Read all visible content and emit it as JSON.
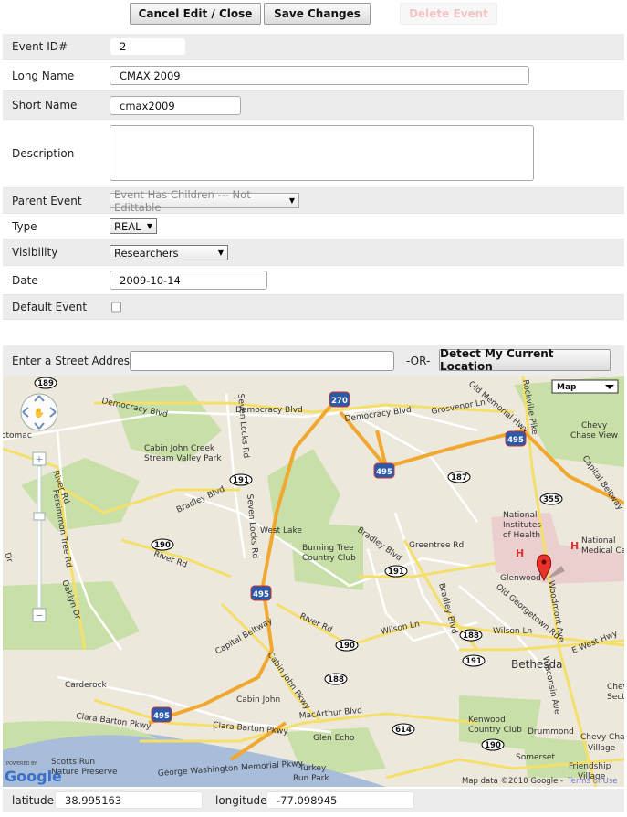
{
  "toolbar": {
    "cancel_label": "Cancel Edit / Close",
    "save_label": "Save Changes",
    "delete_label": "Delete Event"
  },
  "form": {
    "event_id": {
      "label": "Event ID#",
      "value": "2"
    },
    "long_name": {
      "label": "Long Name",
      "value": "CMAX 2009"
    },
    "short_name": {
      "label": "Short Name",
      "value": "cmax2009"
    },
    "description": {
      "label": "Description",
      "value": ""
    },
    "parent_event": {
      "label": "Parent Event",
      "value": "Event Has Children --- Not Edittable"
    },
    "type": {
      "label": "Type",
      "value": "REAL"
    },
    "visibility": {
      "label": "Visibility",
      "value": "Researchers"
    },
    "date": {
      "label": "Date",
      "value": "2009-10-14"
    },
    "default_event": {
      "label": "Default Event",
      "checked": false
    }
  },
  "address": {
    "label": "Enter a Street Address:",
    "value": "",
    "or_label": "-OR-",
    "detect_label": "Detect My Current Location"
  },
  "map": {
    "type_selector": "Map",
    "attribution": "Map data ©2010 Google - ",
    "terms_label": "Terms of Use",
    "logo_powered": "POWERED BY",
    "logo_text": "Google",
    "places": [
      "Cabin John Creek",
      "Stream Valley Park",
      "West Lake",
      "Burning Tree",
      "Country Club",
      "Carderock",
      "Cabin John",
      "Glen Echo",
      "Bethesda",
      "Glenwood",
      "National",
      "Institutes",
      "of Health",
      "National",
      "Medical Ce",
      "Chevy",
      "Chase View",
      "Kenwood",
      "Country Club",
      "Drummond",
      "Somerset",
      "Chevy Cha",
      "Village",
      "Friendship",
      "Village",
      "Scotts Run",
      "Nature Preserve",
      "Turkey",
      "Run Park",
      "otomac",
      "Chev",
      "Sect"
    ],
    "roads": [
      "Democracy Blvd",
      "Democracy Blvd",
      "Democracy Blvd",
      "Grosvenor Ln",
      "Old Memorial Hwy",
      "Rockville Pike",
      "Capital Beltway",
      "Bradley Blvd",
      "Seven Locks Rd",
      "Seven Locks Rd",
      "River Rd",
      "Persimmon Tree Rd",
      "Oaklyn Dr",
      "Bradley Blvd",
      "Greentree Rd",
      "Bradley Blvd",
      "Old Georgetown Rd",
      "Wilson Ln",
      "Wilson Ln",
      "River Rd",
      "Capital Beltway",
      "Cabin John Pkwy",
      "Clara Barton Pkwy",
      "Clara Barton Pkwy",
      "MacArthur Blvd",
      "George Washington Memorial Pkwy",
      "Woodmont Ave",
      "Wisconsin Ave",
      "E West Hwy",
      "River Rd",
      "Dr"
    ],
    "shields": [
      "189",
      "270",
      "495",
      "187",
      "355",
      "191",
      "190",
      "191",
      "188",
      "191",
      "190",
      "188",
      "495",
      "495",
      "614",
      "190",
      "495"
    ]
  },
  "coords": {
    "lat_label": "latitude:",
    "lat_value": "38.995163",
    "lng_label": "longitude:",
    "lng_value": "-77.098945"
  }
}
